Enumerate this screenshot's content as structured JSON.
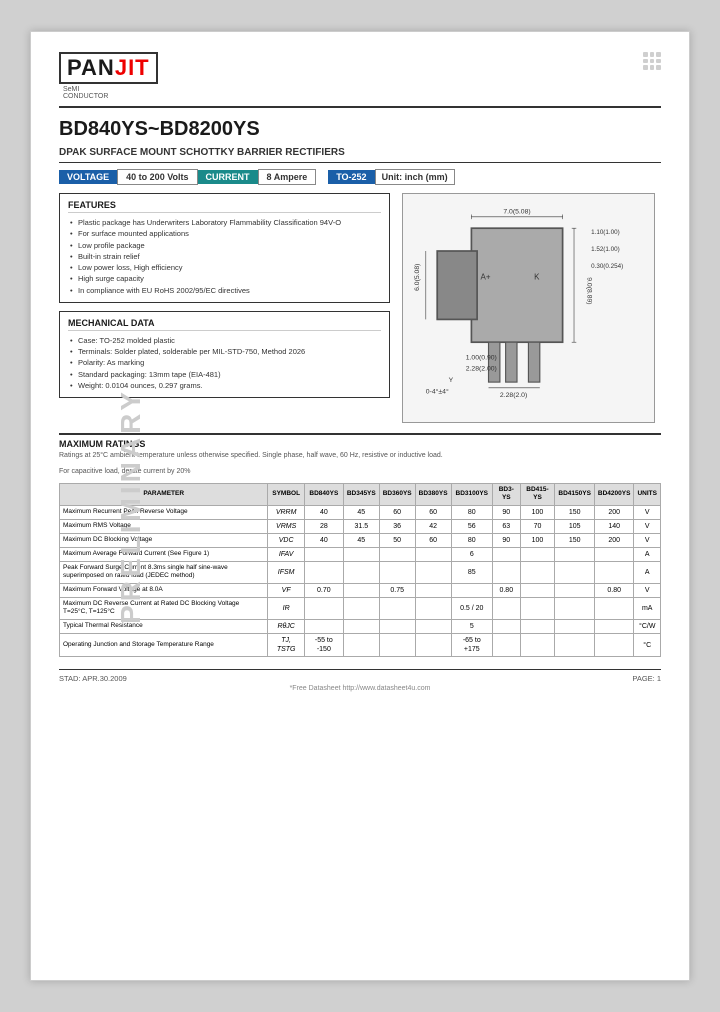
{
  "header": {
    "logo_top": "PAN",
    "logo_bottom": "JIT",
    "logo_sub1": "SeMI",
    "logo_sub2": "CONDUCTOR"
  },
  "title": {
    "part_number": "BD840YS~BD8200YS",
    "subtitle": "DPAK SURFACE MOUNT SCHOTTKY BARRIER RECTIFIERS"
  },
  "badges": {
    "voltage_label": "VOLTAGE",
    "voltage_value": "40 to 200 Volts",
    "current_label": "CURRENT",
    "current_value": "8 Ampere",
    "package_label": "TO-252",
    "unit_label": "Unit: inch (mm)"
  },
  "features": {
    "title": "FEATURES",
    "items": [
      "Plastic package has Underwriters Laboratory Flammability Classification 94V-O",
      "For surface mounted applications",
      "Low profile package",
      "Built-in strain relief",
      "Low power loss, High efficiency",
      "High surge capacity",
      "In compliance with EU RoHS 2002/95/EC directives"
    ]
  },
  "mechdata": {
    "title": "MECHANICAL DATA",
    "items": [
      "Case: TO-252 molded plastic",
      "Terminals: Solder plated, solderable per MIL-STD-750, Method 2026",
      "Polarity: As marking",
      "Standard packaging: 13mm tape (EIA-481)",
      "Weight: 0.0104 ounces, 0.297 grams."
    ]
  },
  "maxratings": {
    "title": "MAXIMUM RATINGS",
    "note1": "Ratings at 25°C ambient temperature unless otherwise specified. Single phase, half wave, 60 Hz, resistive or inductive load.",
    "note2": "For capacitive load, derate current by 20%",
    "table": {
      "headers": [
        "PARAMETER",
        "SYMBOL",
        "BD840YS",
        "BD345YS",
        "BD360YS",
        "BD380YS",
        "BD3100YS",
        "BD3-YS",
        "BD415-YS",
        "BD4150YS",
        "BD4200YS",
        "UNITS"
      ],
      "rows": [
        {
          "param": "Maximum Recurrent Peak Reverse Voltage",
          "symbol": "VRRM",
          "values": [
            "40",
            "45",
            "60",
            "60",
            "80",
            "90",
            "100",
            "150",
            "200",
            "V"
          ]
        },
        {
          "param": "Maximum RMS Voltage",
          "symbol": "VRMS",
          "values": [
            "28",
            "31.5",
            "36",
            "42",
            "56",
            "63",
            "70",
            "105",
            "140",
            "V"
          ]
        },
        {
          "param": "Maximum DC Blocking Voltage",
          "symbol": "VDC",
          "values": [
            "40",
            "45",
            "50",
            "60",
            "80",
            "90",
            "100",
            "150",
            "200",
            "V"
          ]
        },
        {
          "param": "Maximum Average Forward Current (See Figure 1)",
          "symbol": "IFAV",
          "values": [
            "",
            "",
            "",
            "",
            "6",
            "",
            "",
            "",
            "",
            "A"
          ]
        },
        {
          "param": "Peak Forward Surge Current 8.3ms single half sine-wave superimposed on rated load (JEDEC method)",
          "symbol": "IFSM",
          "values": [
            "",
            "",
            "",
            "",
            "85",
            "",
            "",
            "",
            "",
            "A"
          ]
        },
        {
          "param": "Maximum Forward Voltage at 8.0A",
          "symbol": "VF",
          "values": [
            "0.70",
            "",
            "0.75",
            "",
            "",
            "0.80",
            "",
            "",
            "0.80",
            "V"
          ]
        },
        {
          "param": "Maximum DC Reverse Current at Rated DC Blocking Voltage T=25°C, T=125°C",
          "symbol": "IR",
          "values": [
            "",
            "",
            "",
            "",
            "0.5 / 20",
            "",
            "",
            "",
            "",
            "mA"
          ]
        },
        {
          "param": "Typical Thermal Resistance",
          "symbol": "RθJC",
          "values": [
            "",
            "",
            "",
            "",
            "5",
            "",
            "",
            "",
            "",
            "°C/W"
          ]
        },
        {
          "param": "Operating Junction and Storage Temperature Range",
          "symbol": "TJ, TSTG",
          "values": [
            "-55 to -150",
            "",
            "",
            "",
            "-65 to +175",
            "",
            "",
            "",
            "",
            "°C"
          ]
        }
      ]
    }
  },
  "footer": {
    "date": "STAD: APR.30.2009",
    "page": "PAGE: 1",
    "url": "*Free Datasheet http://www.datasheet4u.com"
  }
}
